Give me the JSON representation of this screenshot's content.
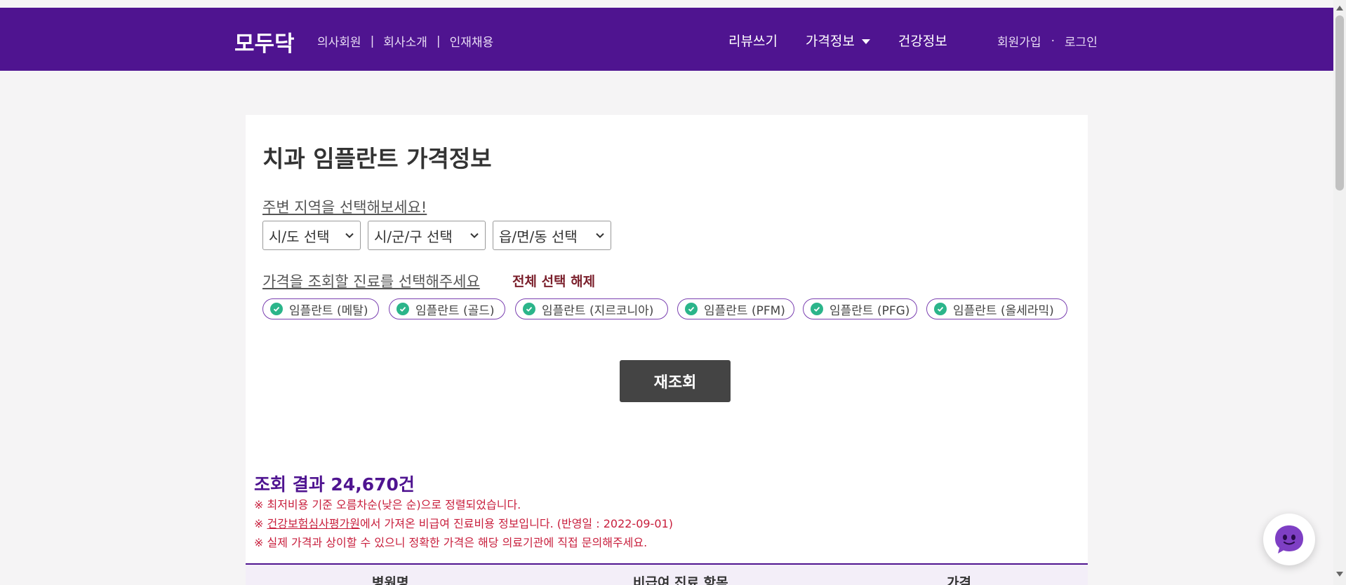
{
  "header": {
    "logo": "모두닥",
    "sublinks": [
      "의사회원",
      "회사소개",
      "인재채용"
    ],
    "separator": "|",
    "menu": {
      "review": "리뷰쓰기",
      "price_info": "가격정보",
      "health_info": "건강정보"
    },
    "account": {
      "signup": "회원가입",
      "dot": "·",
      "login": "로그인"
    }
  },
  "page": {
    "title": "치과 임플란트 가격정보",
    "region_prompt": "주변 지역을 선택해보세요!",
    "selects": {
      "sido": "시/도 선택",
      "sigungu": "시/군/구 선택",
      "eupmyeondong": "읍/면/동 선택"
    },
    "treatment_prompt": "가격을 조회할 진료를 선택해주세요",
    "deselect_all": "전체 선택 해제",
    "chips": [
      "임플란트 (메탈)",
      "임플란트 (골드)",
      "임플란트 (지르코니아)",
      "임플란트 (PFM)",
      "임플란트 (PFG)",
      "임플란트 (올세라믹)"
    ],
    "requery_button": "재조회"
  },
  "results": {
    "title": "조회 결과 24,670건",
    "note1": "※ 최저비용 기준 오름차순(낮은 순)으로 정렬되었습니다.",
    "note2_prefix": "※ ",
    "note2_link": "건강보험심사평가원",
    "note2_suffix": "에서 가져온 비급여 진료비용 정보입니다. (반영일 : 2022-09-01)",
    "note3": "※ 실제 가격과 상이할 수 있으니 정확한 가격은 해당 의료기관에 직접 문의해주세요.",
    "columns": [
      "병원명",
      "비급여 진료 항목",
      "가격"
    ]
  },
  "colors": {
    "brand": "#4f1490",
    "chip_check": "#2bb58a",
    "notice": "#c81e3c",
    "deselect": "#7a1f2b"
  },
  "icons": {
    "caret": "caret-down-icon",
    "select_chevron": "chevron-down-icon",
    "chip_check": "check-circle-icon",
    "chat": "chat-bot-icon"
  }
}
